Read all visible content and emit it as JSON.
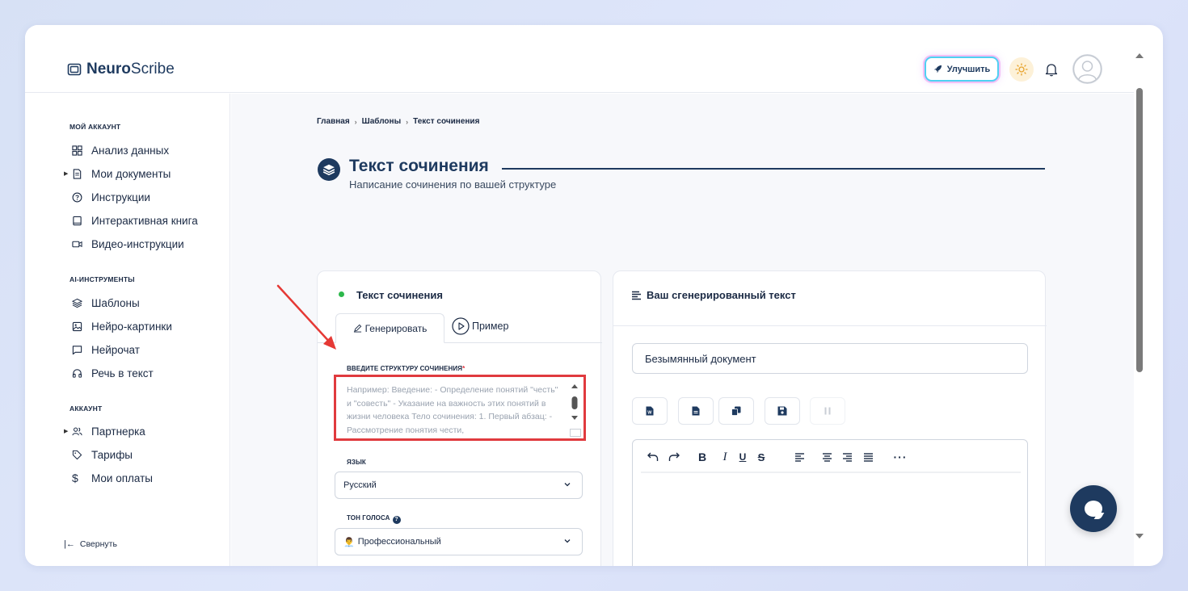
{
  "app": {
    "logo_bold": "Neuro",
    "logo_rest": "Scribe"
  },
  "topbar": {
    "upgrade_label": "Улучшить"
  },
  "sidebar": {
    "section_account": "МОЙ АККАУНТ",
    "items_account": [
      {
        "label": "Анализ данных",
        "icon": "grid-icon"
      },
      {
        "label": "Мои документы",
        "icon": "document-icon"
      },
      {
        "label": "Инструкции",
        "icon": "help-circle-icon"
      },
      {
        "label": "Интерактивная книга",
        "icon": "book-icon"
      },
      {
        "label": "Видео-инструкции",
        "icon": "video-icon"
      }
    ],
    "section_ai": "AI-ИНСТРУМЕНТЫ",
    "items_ai": [
      {
        "label": "Шаблоны",
        "icon": "layers-icon"
      },
      {
        "label": "Нейро-картинки",
        "icon": "image-icon"
      },
      {
        "label": "Нейрочат",
        "icon": "chat-icon"
      },
      {
        "label": "Речь в текст",
        "icon": "headphones-icon"
      }
    ],
    "section_acc": "АККАУНТ",
    "items_acc": [
      {
        "label": "Партнерка",
        "icon": "users-icon"
      },
      {
        "label": "Тарифы",
        "icon": "tag-icon"
      },
      {
        "label": "Мои оплаты",
        "icon": "dollar-icon"
      }
    ],
    "collapse_label": "Свернуть"
  },
  "breadcrumb": [
    "Главная",
    "Шаблоны",
    "Текст сочинения"
  ],
  "page": {
    "title": "Текст сочинения",
    "subtitle": "Написание сочинения по вашей структуре"
  },
  "form": {
    "card_title": "Текст сочинения",
    "tab_generate": "Генерировать",
    "tab_example": "Пример",
    "structure_label": "ВВЕДИТЕ СТРУКТУРУ СОЧИНЕНИЯ",
    "structure_placeholder": "Например:  Введение: - Определение понятий \"честь\" и \"совесть\" - Указание на важность этих понятий в жизни человека  Тело сочинения: 1. Первый абзац: - Рассмотрение понятия чести,",
    "language_label": "ЯЗЫК",
    "language_value": "Русский",
    "tone_label": "ТОН ГОЛОСА",
    "tone_value": "Профессиональный"
  },
  "output": {
    "card_title": "Ваш сгенерированный текст",
    "doc_name": "Безымянный документ"
  },
  "colors": {
    "brand": "#1e3a5f",
    "highlight": "#e03a3e",
    "status_dot": "#2db84c"
  }
}
